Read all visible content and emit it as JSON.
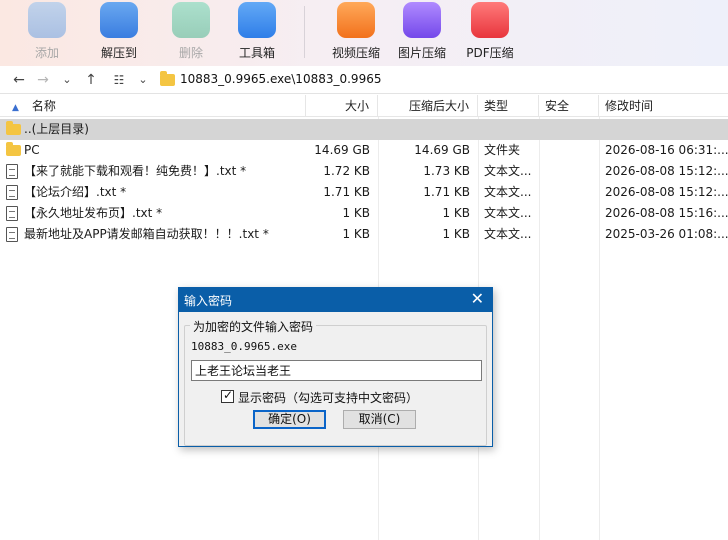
{
  "toolbar": {
    "buttons": [
      {
        "label": "添加",
        "icon": "add-archive-icon",
        "enabled": false,
        "color": "#5aa0e8"
      },
      {
        "label": "解压到",
        "icon": "extract-icon",
        "enabled": true,
        "color": "#4f8fe6"
      },
      {
        "label": "删除",
        "icon": "recycle-icon",
        "enabled": false,
        "color": "#2dbb8c"
      },
      {
        "label": "工具箱",
        "icon": "toolbox-icon",
        "enabled": true,
        "color": "#3b8ff0"
      },
      {
        "label": "视频压缩",
        "icon": "video-compress-icon",
        "enabled": true,
        "color": "#f5842a"
      },
      {
        "label": "图片压缩",
        "icon": "image-compress-icon",
        "enabled": true,
        "color": "#8a5cf0"
      },
      {
        "label": "PDF压缩",
        "icon": "pdf-compress-icon",
        "enabled": true,
        "color": "#f0484e"
      }
    ]
  },
  "address": {
    "path": "10883_0.9965.exe\\10883_0.9965"
  },
  "columns": {
    "name": "名称",
    "size": "大小",
    "packed": "压缩后大小",
    "type": "类型",
    "security": "安全",
    "modified": "修改时间"
  },
  "parent_row": {
    "label": "..(上层目录)"
  },
  "files": [
    {
      "name": "PC",
      "size": "14.69 GB",
      "packed": "14.69 GB",
      "type": "文件夹",
      "security": "",
      "modified": "2026-08-16 06:31:...",
      "kind": "folder"
    },
    {
      "name": "【来了就能下载和观看！纯免费！】.txt *",
      "size": "1.72 KB",
      "packed": "1.73 KB",
      "type": "文本文...",
      "security": "",
      "modified": "2026-08-08 15:12:...",
      "kind": "file"
    },
    {
      "name": "【论坛介绍】.txt *",
      "size": "1.71 KB",
      "packed": "1.71 KB",
      "type": "文本文...",
      "security": "",
      "modified": "2026-08-08 15:12:...",
      "kind": "file"
    },
    {
      "name": "【永久地址发布页】.txt *",
      "size": "1 KB",
      "packed": "1 KB",
      "type": "文本文...",
      "security": "",
      "modified": "2026-08-08 15:16:...",
      "kind": "file"
    },
    {
      "name": "最新地址及APP请发邮箱自动获取！！！.txt *",
      "size": "1 KB",
      "packed": "1 KB",
      "type": "文本文...",
      "security": "",
      "modified": "2025-03-26 01:08:...",
      "kind": "file"
    }
  ],
  "dialog": {
    "title": "输入密码",
    "group_label": "为加密的文件输入密码",
    "filename": "10883_0.9965.exe",
    "password_value": "上老王论坛当老王",
    "show_password_label": "显示密码（勾选可支持中文密码）",
    "show_password_checked": true,
    "ok_label": "确定(O)",
    "cancel_label": "取消(C)"
  }
}
